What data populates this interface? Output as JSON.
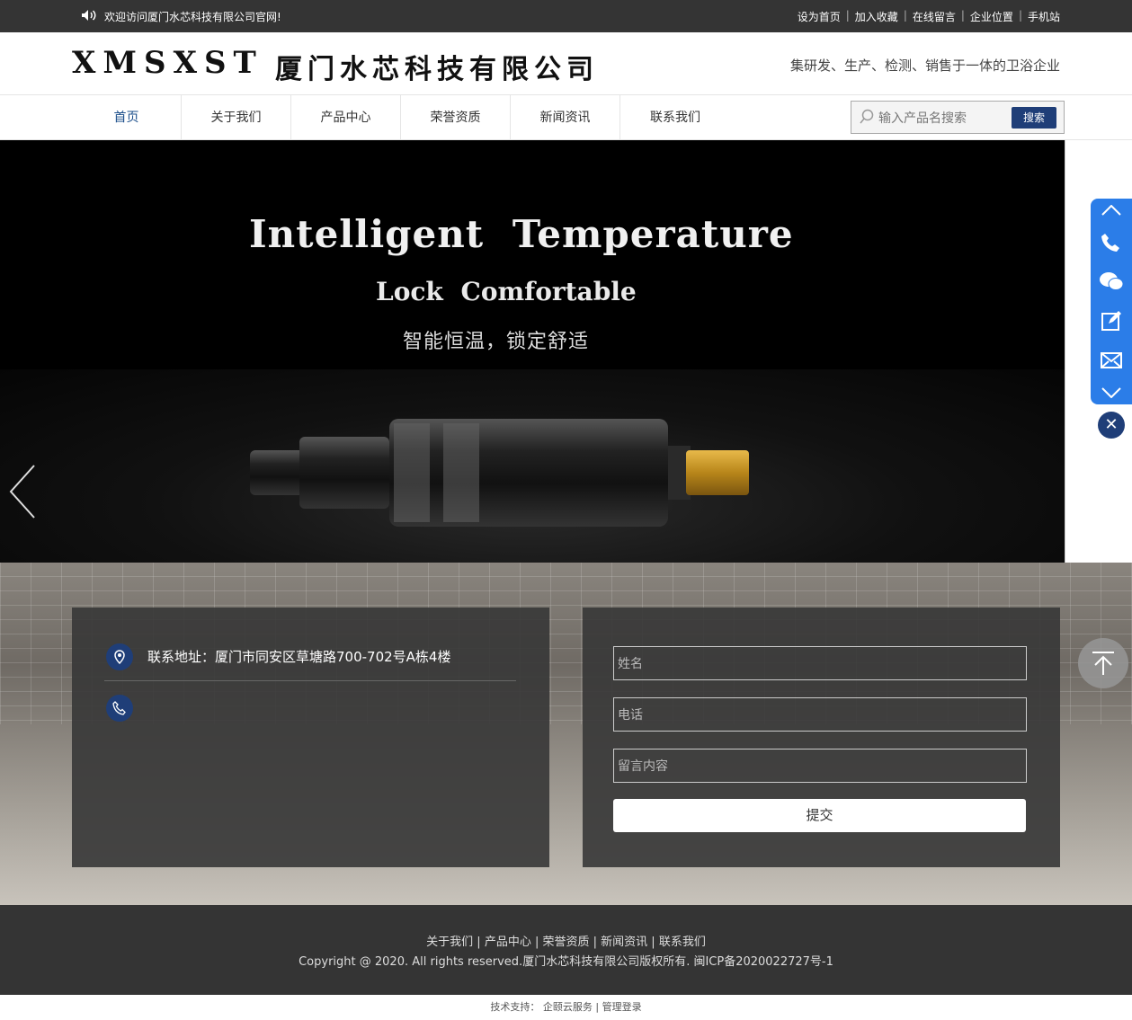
{
  "topbar": {
    "welcome": "欢迎访问厦门水芯科技有限公司官网!",
    "links": [
      "设为首页",
      "加入收藏",
      "在线留言",
      "企业位置",
      "手机站"
    ]
  },
  "header": {
    "logo": "XMSXST",
    "company": "厦门水芯科技有限公司",
    "slogan": "集研发、生产、检测、销售于一体的卫浴企业"
  },
  "nav": {
    "items": [
      "首页",
      "关于我们",
      "产品中心",
      "荣誉资质",
      "新闻资讯",
      "联系我们"
    ],
    "search_placeholder": "输入产品名搜索",
    "search_button": "搜索"
  },
  "banner": {
    "title": "Intelligent Temperature",
    "subtitle": "Lock Comfortable",
    "tagline": "智能恒温，锁定舒适"
  },
  "contact": {
    "address": "联系地址：厦门市同安区草塘路700-702号A栋4楼",
    "form": {
      "name_placeholder": "姓名",
      "phone_placeholder": "电话",
      "message_placeholder": "留言内容",
      "submit": "提交"
    }
  },
  "footer": {
    "links": [
      "关于我们",
      "产品中心",
      "荣誉资质",
      "新闻资讯",
      "联系我们"
    ],
    "copyright": "Copyright @ 2020. All rights reserved.厦门水芯科技有限公司版权所有. 闽ICP备2020022727号-1",
    "support_label": "技术支持：",
    "support_vendor": "企颐云服务",
    "admin_login": "管理登录"
  },
  "colors": {
    "topbar_bg": "#343434",
    "accent": "#1f3e78",
    "side_toolbar": "#2b7de8"
  },
  "icons": [
    "speaker-icon",
    "search-icon",
    "arrow-left-icon",
    "chevron-up-icon",
    "phone-icon",
    "wechat-icon",
    "edit-icon",
    "mail-icon",
    "chevron-down-icon",
    "close-icon",
    "location-icon",
    "phone-circle-icon",
    "back-to-top-icon"
  ]
}
